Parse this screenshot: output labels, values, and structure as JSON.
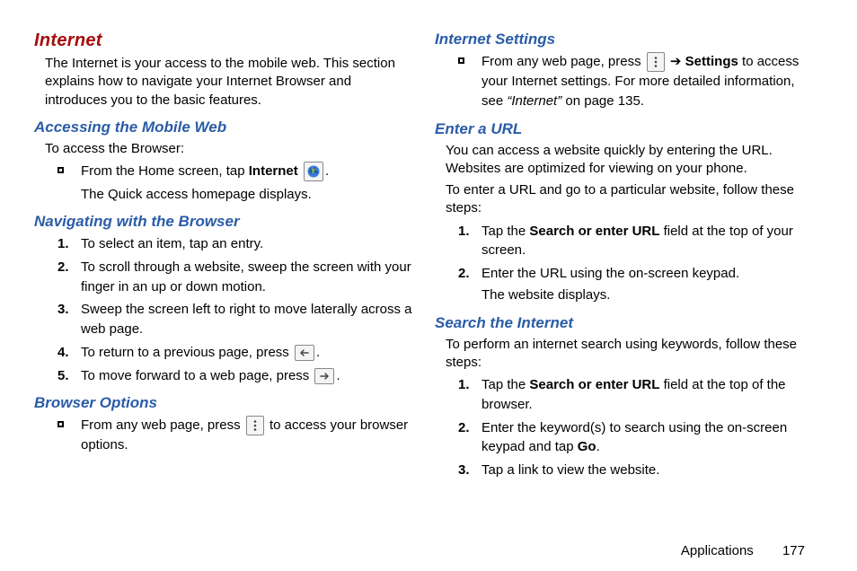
{
  "left": {
    "title": "Internet",
    "intro": "The Internet is your access to the mobile web. This section explains how to navigate your Internet Browser and introduces you to the basic features.",
    "accessing": {
      "heading": "Accessing the Mobile Web",
      "intro": "To access the Browser:",
      "step_pre": "From the Home screen, tap ",
      "step_bold": "Internet",
      "step_post": ".",
      "result": "The Quick access homepage displays."
    },
    "navigating": {
      "heading": "Navigating with the Browser",
      "items": [
        "To select an item, tap an entry.",
        "To scroll through a website, sweep the screen with your finger in an up or down motion.",
        "Sweep the screen left to right to move laterally across a web page."
      ],
      "item4_pre": "To return to a previous page, press ",
      "item4_post": ".",
      "item5_pre": "To move forward to a web page, press ",
      "item5_post": "."
    },
    "browser_options": {
      "heading": "Browser Options",
      "pre": "From any web page, press ",
      "post": " to access your browser options."
    }
  },
  "right": {
    "internet_settings": {
      "heading": "Internet Settings",
      "pre": "From any web page, press ",
      "mid": " ➔ ",
      "bold": "Settings",
      "post": " to access your Internet settings. For more detailed information, see ",
      "ref": "“Internet”",
      "ref_post": " on page 135."
    },
    "enter_url": {
      "heading": "Enter a URL",
      "p1": "You can access a website quickly by entering the URL. Websites are optimized for viewing on your phone.",
      "p2": "To enter a URL and go to a particular website, follow these steps:",
      "item1_pre": "Tap the ",
      "item1_bold": "Search or enter URL",
      "item1_post": " field at the top of your screen.",
      "item2": "Enter the URL using the on-screen keypad.",
      "item2_result": "The website displays."
    },
    "search": {
      "heading": "Search the Internet",
      "intro": "To perform an internet search using keywords, follow these steps:",
      "item1_pre": "Tap the ",
      "item1_bold": "Search or enter URL",
      "item1_post": " field at the top of the browser.",
      "item2_pre": "Enter the keyword(s) to search using the on-screen keypad and tap ",
      "item2_bold": "Go",
      "item2_post": ".",
      "item3": "Tap a link to view the website."
    }
  },
  "footer": {
    "section": "Applications",
    "page": "177"
  }
}
